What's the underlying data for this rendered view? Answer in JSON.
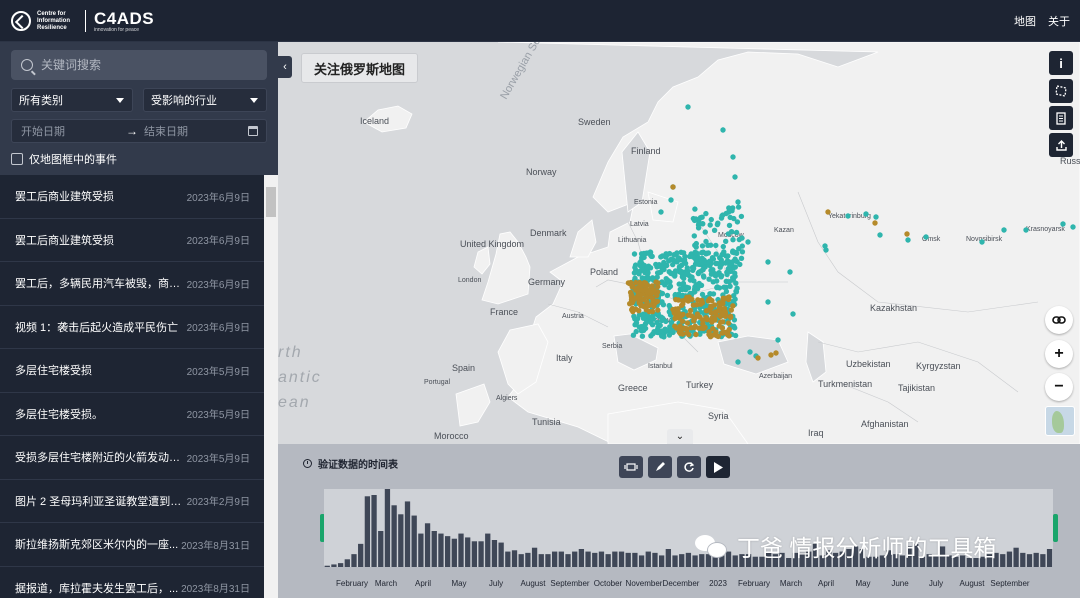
{
  "header": {
    "logo_org": "Centre for Information Resilience",
    "logo_brand": "C4ADS",
    "logo_tagline": "innovation for peace",
    "nav": [
      "地图",
      "关于"
    ]
  },
  "filters": {
    "search_placeholder": "关键词搜索",
    "category": "所有类别",
    "industry": "受影响的行业",
    "start_date": "开始日期",
    "end_date": "结束日期",
    "only_in_map": "仅地图框中的事件"
  },
  "events": [
    {
      "title": "罢工后商业建筑受损",
      "date": "2023年6月9日"
    },
    {
      "title": "罢工后商业建筑受损",
      "date": "2023年6月9日"
    },
    {
      "title": "罢工后，多辆民用汽车被毁，商业...",
      "date": "2023年6月9日"
    },
    {
      "title": "视频 1：袭击后起火造成平民伤亡",
      "date": "2023年6月9日"
    },
    {
      "title": "多层住宅楼受损",
      "date": "2023年5月9日"
    },
    {
      "title": "多层住宅楼受损。",
      "date": "2023年5月9日"
    },
    {
      "title": "受损多层住宅楼附近的火箭发动机...",
      "date": "2023年5月9日"
    },
    {
      "title": "图片 2 圣母玛利亚圣诞教堂遭到破...",
      "date": "2023年2月9日"
    },
    {
      "title": "斯拉维扬斯克郊区米尔内的一座...",
      "date": "2023年8月31日"
    },
    {
      "title": "据报道，库拉霍夫发生罢工后，...",
      "date": "2023年8月31日"
    }
  ],
  "map": {
    "title": "关注俄罗斯地图",
    "labels": [
      "Norwegian Sea",
      "Iceland",
      "Sweden",
      "Finland",
      "Norway",
      "Estonia",
      "Latvia",
      "Lithuania",
      "Denmark",
      "United Kingdom",
      "London",
      "Poland",
      "Germany",
      "France",
      "Austria",
      "Moldova",
      "Serbia",
      "Italy",
      "Spain",
      "Portugal",
      "Greece",
      "Turkey",
      "Istanbul",
      "Syria",
      "Tunisia",
      "Algiers",
      "Morocco",
      "Iraq",
      "Afghanistan",
      "Kazakhstan",
      "Uzbekistan",
      "Turkmenistan",
      "Kyrgyzstan",
      "Tajikistan",
      "Azerbaijan",
      "Kazan",
      "Yekaterinburg",
      "Omsk",
      "Novosibirsk",
      "Krasnoyarsk",
      "Russ",
      "Moscow",
      "Atlantic Ocean"
    ],
    "atlantic_lines": [
      "rth",
      "antic",
      "ean"
    ],
    "tools": [
      "info-icon",
      "polygon-icon",
      "document-icon",
      "upload-icon"
    ],
    "zoom_in": "+",
    "zoom_out": "−",
    "teal": "#2fb5ad",
    "gold": "#b58a2a"
  },
  "timeline": {
    "title": "验证数据的时间表",
    "buttons": [
      "rotate-icon",
      "rocket-icon",
      "refresh-icon",
      "play-icon"
    ],
    "months": [
      "February",
      "March",
      "April",
      "May",
      "July",
      "August",
      "September",
      "October",
      "November",
      "December",
      "2023",
      "February",
      "March",
      "April",
      "May",
      "June",
      "July",
      "August",
      "September"
    ],
    "bar_color": "#3f4757",
    "counts": [
      1,
      2,
      3,
      6,
      10,
      18,
      55,
      56,
      28,
      64,
      48,
      41,
      51,
      40,
      26,
      34,
      28,
      26,
      24,
      22,
      26,
      23,
      20,
      20,
      26,
      21,
      19,
      12,
      13,
      10,
      11,
      15,
      10,
      10,
      12,
      12,
      10,
      12,
      14,
      12,
      11,
      12,
      10,
      12,
      12,
      11,
      11,
      9,
      12,
      11,
      9,
      14,
      9,
      10,
      11,
      9,
      10,
      10,
      9,
      10,
      12,
      9,
      10,
      10,
      8,
      8,
      11,
      10,
      11,
      7,
      11,
      11,
      12,
      18,
      9,
      13,
      11,
      12,
      14,
      16,
      14,
      8,
      8,
      9,
      13,
      10,
      9,
      16,
      18,
      8,
      10,
      9,
      16,
      9,
      8,
      9,
      7,
      7,
      8,
      10,
      11,
      10,
      12,
      15,
      11,
      10,
      11,
      10,
      14
    ]
  },
  "watermark": "丁爸 情报分析师的工具箱"
}
